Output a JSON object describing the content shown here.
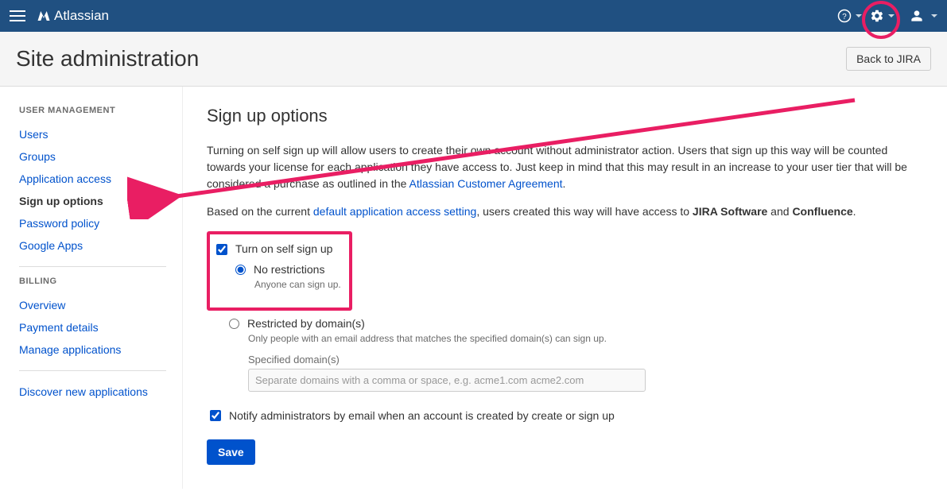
{
  "brand": "Atlassian",
  "header": {
    "title": "Site administration",
    "back_button": "Back to JIRA"
  },
  "sidebar": {
    "section1_heading": "USER MANAGEMENT",
    "items1": [
      "Users",
      "Groups",
      "Application access",
      "Sign up options",
      "Password policy",
      "Google Apps"
    ],
    "active1_index": 3,
    "section2_heading": "BILLING",
    "items2": [
      "Overview",
      "Payment details",
      "Manage applications"
    ],
    "discover": "Discover new applications"
  },
  "content": {
    "title": "Sign up options",
    "para1_pre": "Turning on self sign up will allow users to create their own account without administrator action. Users that sign up this way will be counted towards your license for each application they have access to. Just keep in mind that this may result in an increase to your user tier that will be considered a purchase as outlined in the ",
    "para1_link": "Atlassian Customer Agreement",
    "para1_post": ".",
    "para2_pre": "Based on the current ",
    "para2_link": "default application access setting",
    "para2_mid": ", users created this way will have access to ",
    "para2_app1": "JIRA Software",
    "para2_and": " and ",
    "para2_app2": "Confluence",
    "para2_post": ".",
    "checkbox_signup": "Turn on self sign up",
    "radio_no_restrictions": "No restrictions",
    "radio_no_restrictions_hint": "Anyone can sign up.",
    "radio_restricted": "Restricted by domain(s)",
    "radio_restricted_hint": "Only people with an email address that matches the specified domain(s) can sign up.",
    "domain_label": "Specified domain(s)",
    "domain_placeholder": "Separate domains with a comma or space, e.g. acme1.com acme2.com",
    "notify_label": "Notify administrators by email when an account is created by create or sign up",
    "save": "Save"
  }
}
